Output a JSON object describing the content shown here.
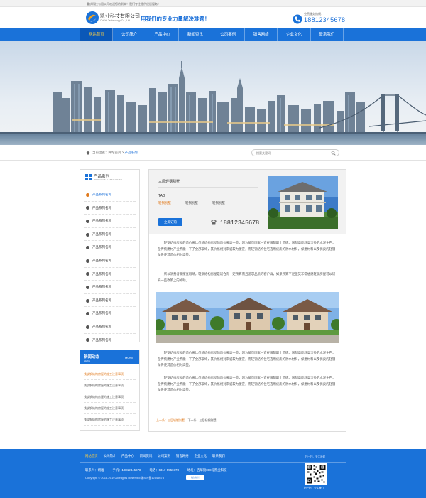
{
  "topbar": {
    "text": "重庆科技有限公司欢迎您的到来！我们专注提供优质服务！"
  },
  "header": {
    "company_name": "凯业科技有限公司",
    "company_sub": "Chi Ye Technology Co., Ltd.",
    "slogan": "用我们的专业力量解决难题！",
    "phone_caption": "免费服务热线：",
    "phone": "18812345678"
  },
  "nav": {
    "items": [
      "网站首页",
      "公司简介",
      "产品中心",
      "新闻资讯",
      "公司案例",
      "销售网络",
      "企业文化",
      "联系我们"
    ],
    "active_index": 0
  },
  "breadcrumb": {
    "label": "当前位置：",
    "home": "网站首页",
    "sep": " > ",
    "current": "产品系列"
  },
  "search": {
    "placeholder": "搜索关键词"
  },
  "sidebar": {
    "title": "产品系列",
    "subtitle": "PRODUCT CATEGORIES",
    "items": [
      "产品系列名称",
      "产品系列名称",
      "产品系列名称",
      "产品系列名称",
      "产品系列名称",
      "产品系列名称",
      "产品系列名称",
      "产品系列名称",
      "产品系列名称",
      "产品系列名称",
      "产品系列名称",
      "产品系列名称"
    ],
    "active_index": 0
  },
  "news": {
    "title": "新闻动态",
    "subtitle": "NEWS",
    "more": "MORE",
    "items": [
      "浅谈钢结构房屋的施工注意事项",
      "浅谈钢结构房屋的施工注意事项",
      "浅谈钢结构房屋的施工注意事项",
      "浅谈钢结构房屋的施工注意事项",
      "浅谈钢结构房屋的施工注意事项"
    ],
    "active_index": 0
  },
  "product": {
    "title": "三层轻钢别墅",
    "tag_label": "TAG",
    "tags": [
      "轻钢别墅",
      "轻钢别墅",
      "轻钢别墅"
    ],
    "order_button": "立即订购",
    "phone": "18812345678",
    "paragraphs": [
      "轻钢结构房屋的造价要比传统结构房屋的造价要高一些，因为虽然国家一直在限制取土造砖、限制高能耗高污染的水泥生产，但传统建材产业不能一下子全部取缔，其价格相对来说较为便宜，而轻钢结构住宅选用优质的防水材料，保温材料以及优良的轻钢龙骨使其造价相对高些。",
      "所以消费者要擦亮眼睛，轻钢结构房屋是适合有一定预算而且追求品质的客户群，如果预算不足但又非常想建轻钢房屋可以研究一些政策上的补助。",
      "轻钢结构房屋的造价要比传统结构房屋的造价要高一些，因为虽然国家一直在限制取土造砖、限制高能耗高污染的水泥生产，但传统建材产业不能一下子全部取缔，其价格相对来说较为便宜，而轻钢结构住宅选用优质的防水材料，保温材料以及优良的轻钢龙骨使其造价相对高些。",
      "轻钢结构房屋的造价要比传统结构房屋的造价要高一些，因为虽然国家一直在限制取土造砖、限制高能耗高污染的水泥生产，但传统建材产业不能一下子全部取缔，其价格相对来说较为便宜，而轻钢结构住宅选用优质的防水材料，保温材料以及优良的轻钢龙骨使其造价相对高些。"
    ],
    "prev": "上一条：三层轻钢别墅",
    "next": "下一条：三层轻钢别墅"
  },
  "footer": {
    "nav": [
      "网站首页",
      "公司简介",
      "产品中心",
      "新闻资讯",
      "公司案例",
      "销售网络",
      "企业文化",
      "联系我们"
    ],
    "contact": "联系人：胡雅",
    "mobile": "手机：18812345678",
    "tel": "电话：0317-5556778",
    "address": "地址：吉华街388号凯业科技",
    "copyright": "Copyright © 2018-2019 All Rights Reserved 渝ICP备12345678",
    "badge": "站长统计",
    "sub": "扫一扫，关注我们",
    "qr_caption": "扫一扫，关注我们"
  },
  "colors": {
    "brand": "#1a72d9",
    "accent": "#e07a1d",
    "highlight": "#ffcf40"
  }
}
